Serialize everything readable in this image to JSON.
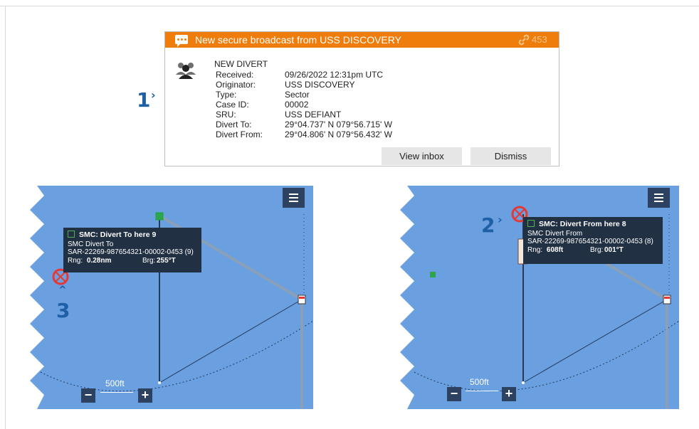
{
  "colors": {
    "orange": "#ef7d0b",
    "map_blue": "#6a9fe0",
    "panel_dark": "#223044",
    "callout_blue": "#1f5fa6"
  },
  "notification": {
    "header_title": "New secure broadcast from USS DISCOVERY",
    "header_icon": "message-icon",
    "link_icon": "link-icon",
    "link_count": "453",
    "user_icon": "user-group-icon",
    "heading": "NEW DIVERT",
    "fields": [
      {
        "label": "Received:",
        "value": "09/26/2022 12:31pm UTC"
      },
      {
        "label": "Originator:",
        "value": "USS DISCOVERY"
      },
      {
        "label": "Type:",
        "value": "Sector"
      },
      {
        "label": "Case ID:",
        "value": "00002"
      },
      {
        "label": "SRU:",
        "value": "USS DEFIANT"
      },
      {
        "label": "Divert To:",
        "value": "29°04.737' N 079°56.715' W"
      },
      {
        "label": "Divert From:",
        "value": "29°04.806' N 079°56.432' W"
      }
    ],
    "view_inbox_label": "View inbox",
    "dismiss_label": "Dismiss"
  },
  "callouts": {
    "one": "1",
    "two": "2",
    "three": "3"
  },
  "map_left": {
    "menu_icon": "menu-icon",
    "popup": {
      "title": "SMC: Divert To here 9",
      "line1": "SMC Divert To",
      "line2": "SAR-22269-987654321-00002-0453 (9)",
      "rng_label": "Rng:",
      "rng_value": "0.28nm",
      "brg_label": "Brg:",
      "brg_value": "255°T"
    },
    "scale": "500ft",
    "zoom_out": "−",
    "zoom_in": "+"
  },
  "map_right": {
    "menu_icon": "menu-icon",
    "popup": {
      "title": "SMC: Divert From here 8",
      "line1": "SMC Divert From",
      "line2": "SAR-22269-987654321-00002-0453 (8)",
      "rng_label": "Rng:",
      "rng_value": "608ft",
      "brg_label": "Brg:",
      "brg_value": "001°T"
    },
    "scale": "500ft",
    "zoom_out": "−",
    "zoom_in": "+"
  }
}
